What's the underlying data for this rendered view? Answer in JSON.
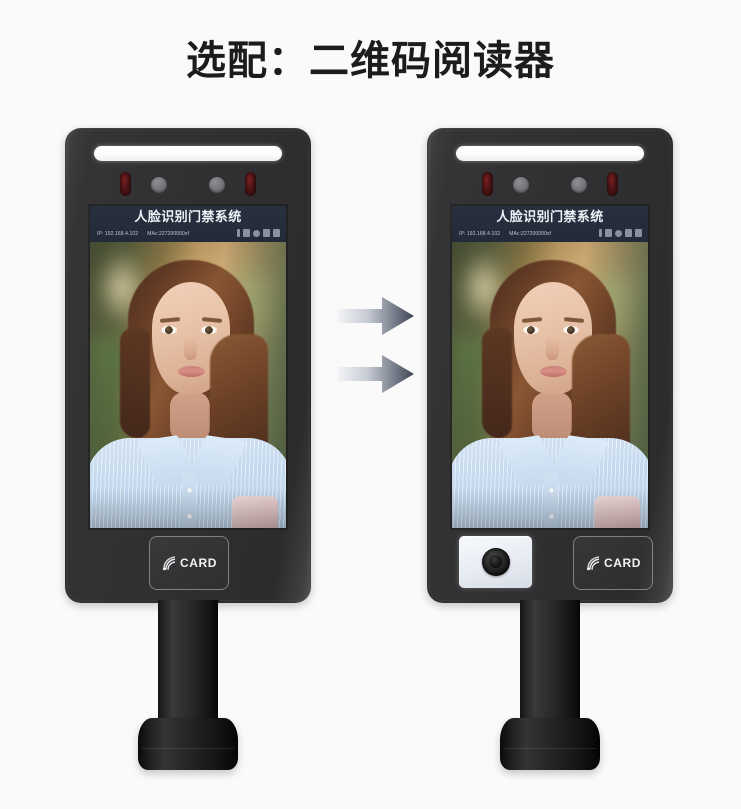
{
  "page": {
    "title": "选配：二维码阅读器",
    "background_color": "#fafafb"
  },
  "devices": [
    {
      "id": "device-base",
      "position": "left",
      "description": "人脸识别门禁终端（标准配置）",
      "screen": {
        "title": "人脸识别门禁系统",
        "ip_label": "IP:  192.168.4.102",
        "mac_label": "MAc:227200000sf",
        "status_icons": [
          "signal-icon",
          "wifi-icon",
          "network-icon",
          "battery-icon",
          "menu-icon"
        ],
        "background_color": "#232a38"
      },
      "sensors": {
        "led_bar": "white-led-fill-light",
        "ir_leds": [
          "ir-led-left",
          "ir-led-right"
        ],
        "cameras": [
          "camera-lens-left",
          "camera-lens-right"
        ]
      },
      "modules": [
        {
          "type": "card-reader",
          "label": "CARD",
          "icon": "rfid-wave-icon"
        }
      ]
    },
    {
      "id": "device-qr",
      "position": "right",
      "description": "人脸识别门禁终端（加装二维码阅读器）",
      "screen": {
        "title": "人脸识别门禁系统",
        "ip_label": "IP:  192.168.4.102",
        "mac_label": "MAc:227200000sf",
        "status_icons": [
          "signal-icon",
          "wifi-icon",
          "network-icon",
          "battery-icon",
          "menu-icon"
        ],
        "background_color": "#232a38"
      },
      "sensors": {
        "led_bar": "white-led-fill-light",
        "ir_leds": [
          "ir-led-left",
          "ir-led-right"
        ],
        "cameras": [
          "camera-lens-left",
          "camera-lens-right"
        ]
      },
      "modules": [
        {
          "type": "qr-code-reader",
          "label": "",
          "icon": "qr-scanner-lens-icon"
        },
        {
          "type": "card-reader",
          "label": "CARD",
          "icon": "rfid-wave-icon"
        }
      ]
    }
  ],
  "arrows": {
    "count": 2,
    "direction": "right",
    "gradient_from": "#f0f1f4",
    "gradient_to": "#454b57"
  },
  "colors": {
    "device_body": "#303032",
    "screen_header": "#232a38",
    "led_white": "#ffffff",
    "ir_red": "#4a1414",
    "qr_module_white": "#eef1f6",
    "title_text": "#1c1c1c"
  }
}
